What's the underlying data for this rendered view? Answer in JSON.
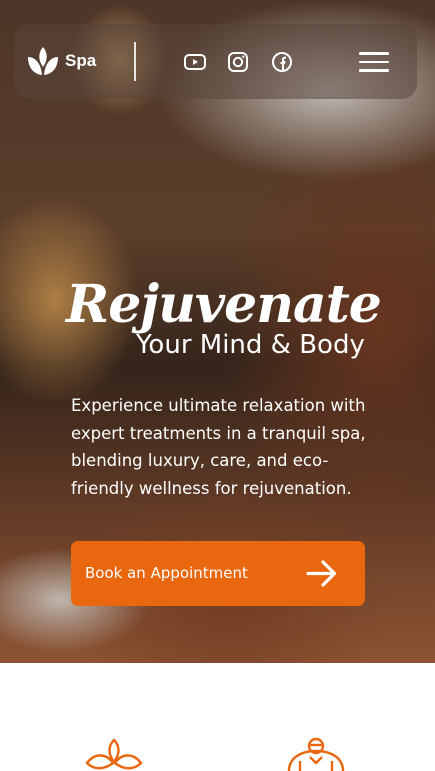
{
  "header": {
    "brand": "Spa",
    "icons": [
      "lotus-logo-icon",
      "youtube-icon",
      "instagram-icon",
      "facebook-icon",
      "hamburger-menu-icon"
    ]
  },
  "hero": {
    "script_title": "Rejuvenate",
    "subtitle": "Your Mind & Body",
    "description": "Experience ultimate relaxation with expert treatments in a tranquil spa, blending luxury, care, and eco-friendly wellness for rejuvenation.",
    "cta_label": "Book an Appointment"
  },
  "features": {
    "icons": [
      "leaf-sprout-icon",
      "therapist-icon"
    ]
  },
  "colors": {
    "accent": "#e8670f",
    "white": "#ffffff"
  }
}
